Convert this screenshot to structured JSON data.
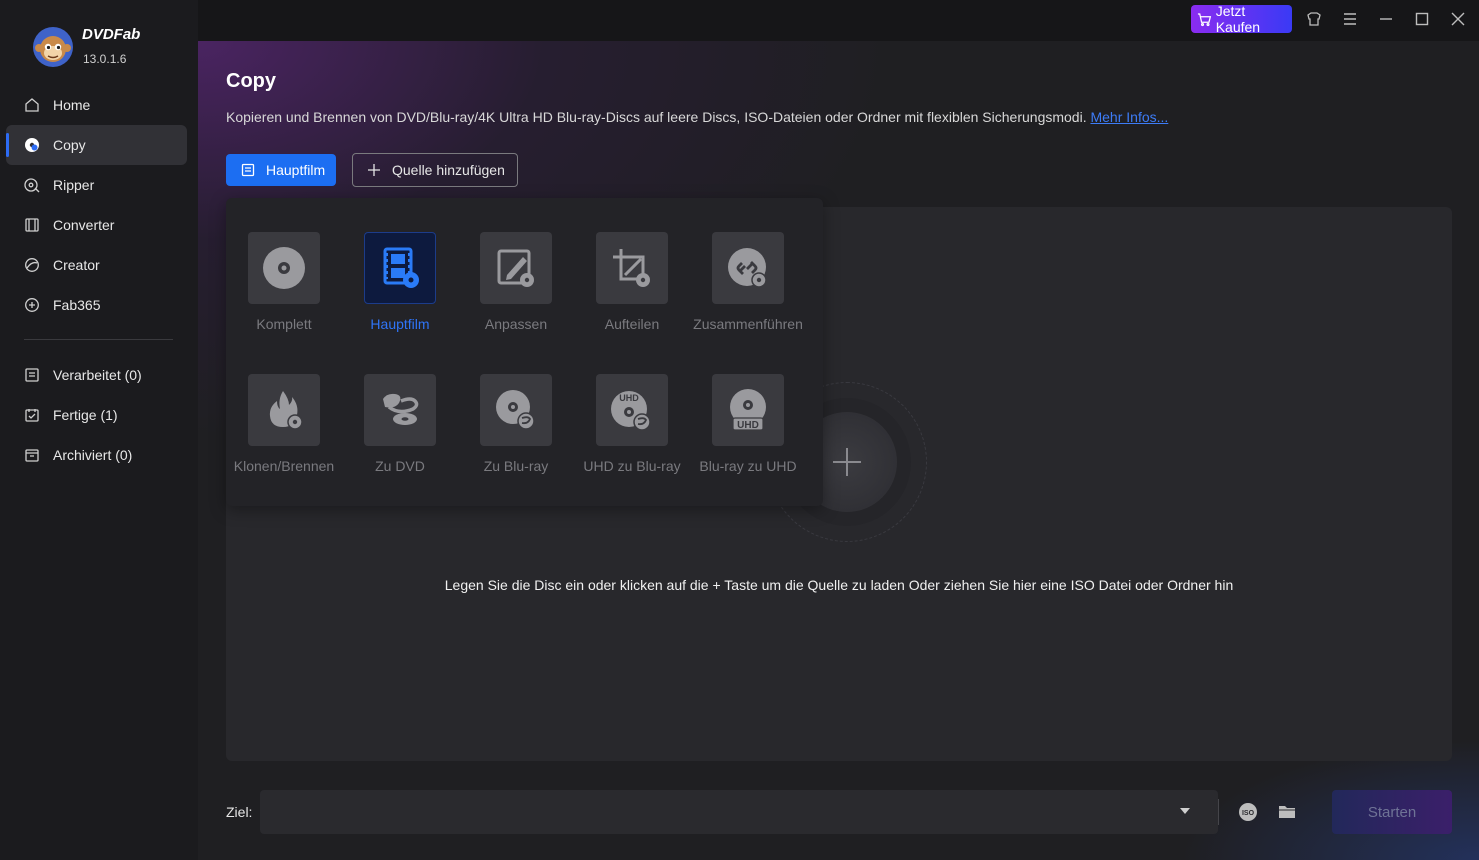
{
  "app": {
    "name": "DVDFab",
    "version": "13.0.1.6"
  },
  "titlebar": {
    "buy_label": "Jetzt Kaufen"
  },
  "sidebar": {
    "items": [
      {
        "label": "Home",
        "icon": "home-icon"
      },
      {
        "label": "Copy",
        "icon": "copy-disc-icon",
        "active": true
      },
      {
        "label": "Ripper",
        "icon": "ripper-icon"
      },
      {
        "label": "Converter",
        "icon": "converter-icon"
      },
      {
        "label": "Creator",
        "icon": "creator-icon"
      },
      {
        "label": "Fab365",
        "icon": "fab365-icon"
      }
    ],
    "queue": [
      {
        "label": "Verarbeitet (0)",
        "icon": "processed-icon"
      },
      {
        "label": "Fertige (1)",
        "icon": "finished-icon"
      },
      {
        "label": "Archiviert (0)",
        "icon": "archive-icon"
      }
    ]
  },
  "main": {
    "title": "Copy",
    "description": "Kopieren und Brennen von DVD/Blu-ray/4K Ultra HD Blu-ray-Discs auf leere Discs, ISO-Dateien oder Ordner mit flexiblen Sicherungsmodi.",
    "more_link": "Mehr Infos...",
    "mode_button": "Hauptfilm",
    "add_source_button": "Quelle hinzufügen",
    "drop_hint": "Legen Sie die Disc ein oder klicken auf die + Taste um die Quelle zu laden Oder ziehen Sie hier eine ISO Datei oder Ordner hin",
    "modes": [
      {
        "label": "Komplett",
        "icon": "disc-icon"
      },
      {
        "label": "Hauptfilm",
        "icon": "film-icon",
        "active": true
      },
      {
        "label": "Anpassen",
        "icon": "customize-icon"
      },
      {
        "label": "Aufteilen",
        "icon": "split-icon"
      },
      {
        "label": "Zusammenführen",
        "icon": "merge-icon"
      },
      {
        "label": "Klonen/Brennen",
        "icon": "clone-burn-icon"
      },
      {
        "label": "Zu DVD",
        "icon": "to-dvd-icon"
      },
      {
        "label": "Zu Blu-ray",
        "icon": "to-bluray-icon"
      },
      {
        "label": "UHD zu Blu-ray",
        "icon": "uhd-to-bluray-icon"
      },
      {
        "label": "Blu-ray zu UHD",
        "icon": "bluray-to-uhd-icon"
      }
    ]
  },
  "output": {
    "label": "Ziel:",
    "value": "",
    "start_button": "Starten"
  },
  "colors": {
    "accent": "#1c6ef2",
    "buy_gradient_start": "#8a2cf0",
    "buy_gradient_end": "#3a3af5",
    "link": "#3d7cf7"
  }
}
